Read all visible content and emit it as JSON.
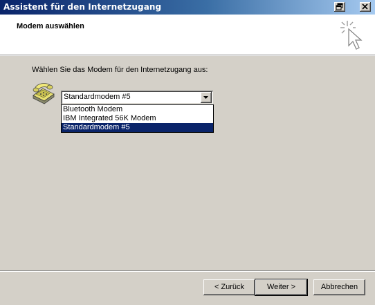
{
  "window": {
    "title": "Assistent für den Internetzugang"
  },
  "header": {
    "title": "Modem auswählen",
    "icon": "wizard-wand-icon"
  },
  "main": {
    "instruction": "Wählen Sie das Modem für den Internetzugang aus:",
    "icon": "telephone-icon",
    "modem_select": {
      "value": "Standardmodem #5",
      "options": [
        "Bluetooth Modem",
        "IBM Integrated 56K Modem",
        "Standardmodem #5"
      ],
      "selected_index": 2
    }
  },
  "footer": {
    "back_label": "< Zurück",
    "next_label": "Weiter >",
    "cancel_label": "Abbrechen"
  },
  "colors": {
    "titlebar_start": "#0a246a",
    "titlebar_end": "#a6caf0",
    "selection": "#0a246a",
    "face": "#d4d0c8"
  }
}
